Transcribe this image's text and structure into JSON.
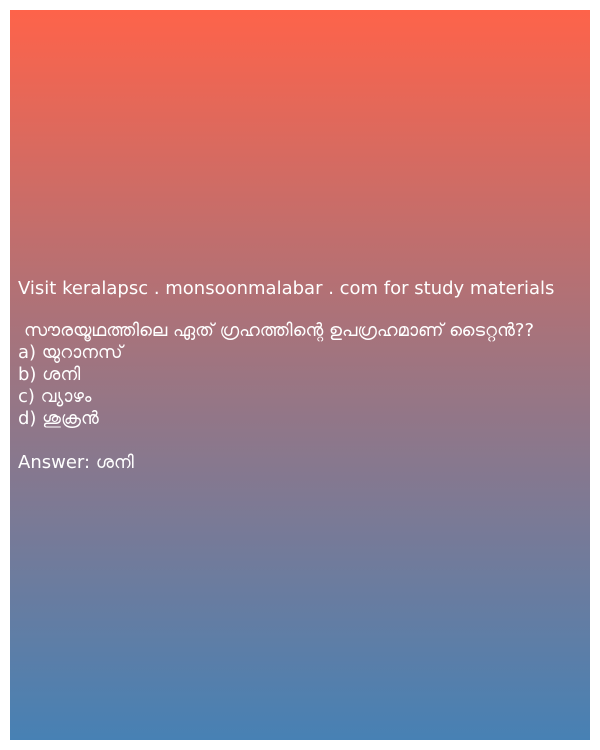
{
  "promo_text": "Visit keralapsc . monsoonmalabar . com for study materials",
  "question": "സൗരയൂഥത്തിലെ ഏത് ഗ്രഹത്തിന്റെ ഉപഗ്രഹമാണ് ടൈറ്റൻ??",
  "options": [
    "a) യുറാനസ്",
    "b) ശനി",
    "c) വ്യാഴം",
    "d) ശുക്രൻ"
  ],
  "answer": "Answer: ശനി",
  "colors": {
    "gradient_top": "#fe634a",
    "gradient_mid": "#9c7582",
    "gradient_bottom": "#4781b4",
    "text": "#ffffff"
  }
}
